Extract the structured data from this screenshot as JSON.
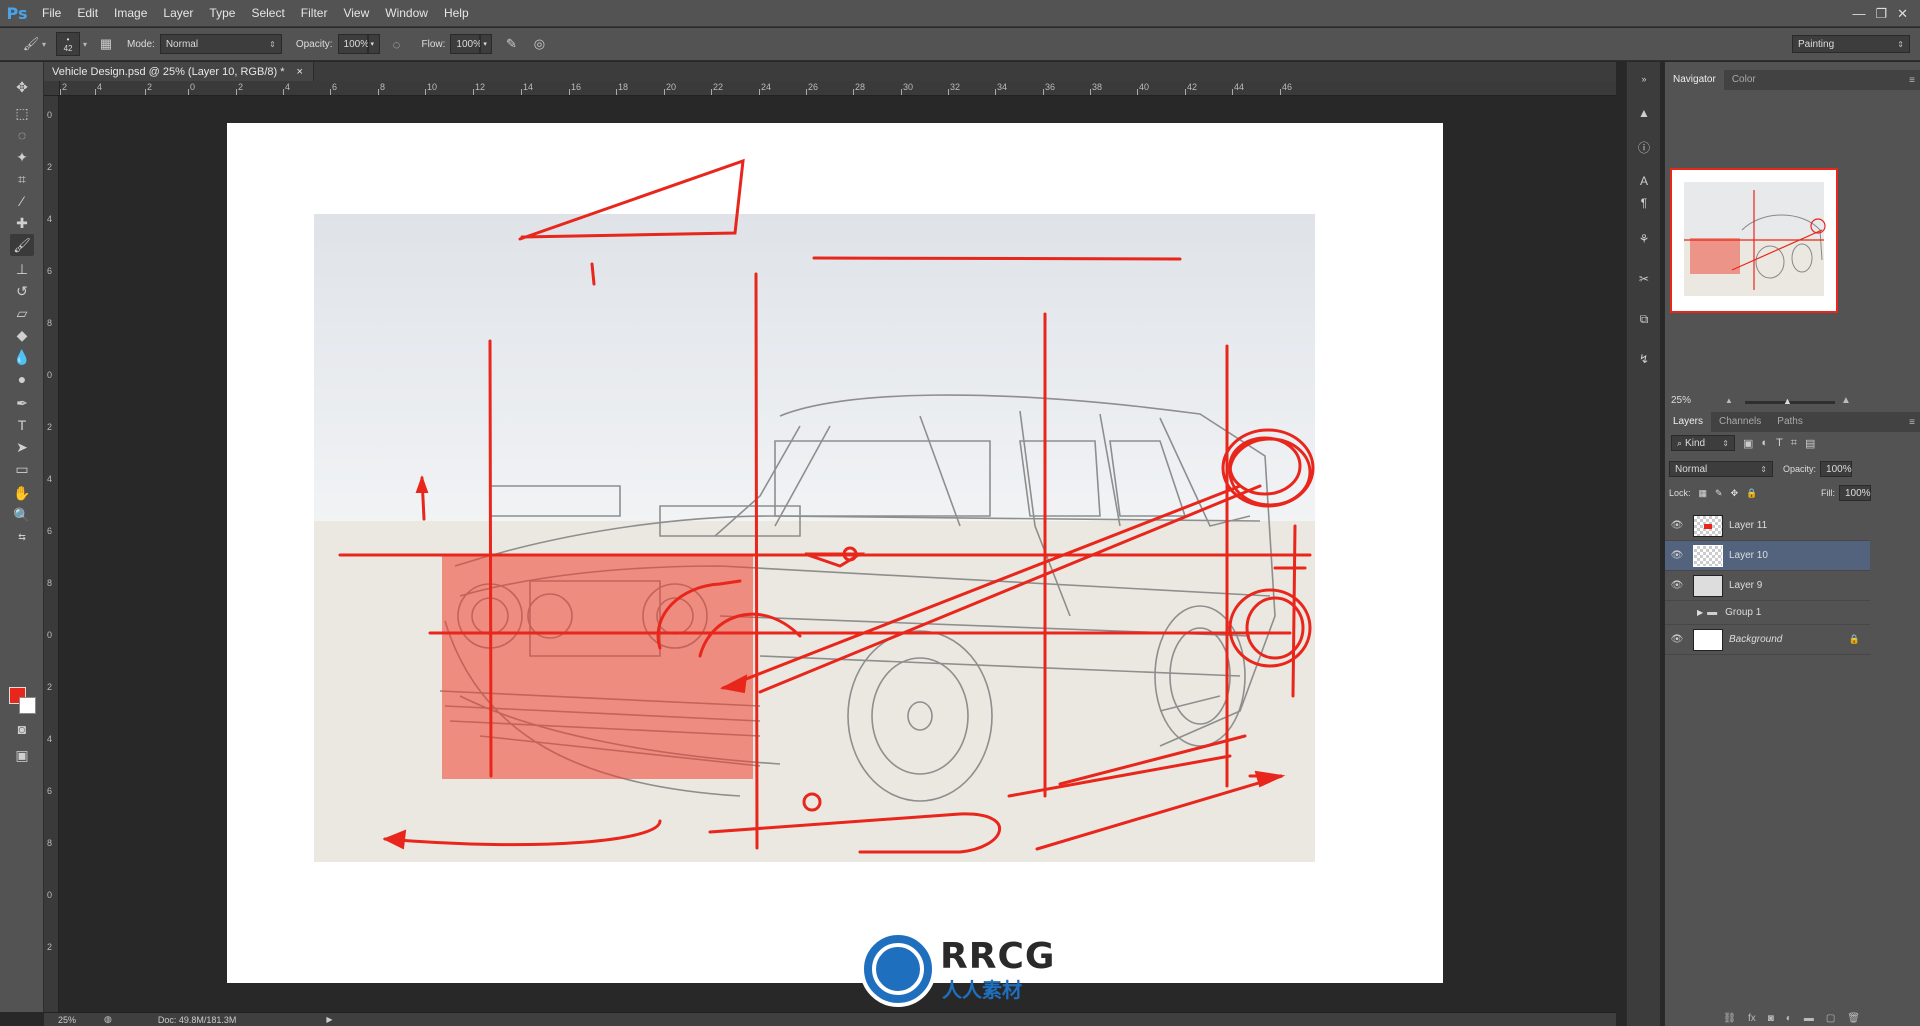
{
  "app": {
    "logo": "Ps"
  },
  "menu": [
    "File",
    "Edit",
    "Image",
    "Layer",
    "Type",
    "Select",
    "Filter",
    "View",
    "Window",
    "Help"
  ],
  "window_controls": [
    "—",
    "❐",
    "✕"
  ],
  "options": {
    "brush_size": "42",
    "mode_label": "Mode:",
    "mode_value": "Normal",
    "opacity_label": "Opacity:",
    "opacity_value": "100%",
    "flow_label": "Flow:",
    "flow_value": "100%",
    "workspace": "Painting"
  },
  "document_tab": {
    "title": "Vehicle Design.psd @ 25% (Layer 10, RGB/8) *",
    "close": "×"
  },
  "ruler_top_labels": [
    "2",
    "4",
    "2",
    "0",
    "2",
    "4",
    "6",
    "8",
    "10",
    "12",
    "14",
    "16",
    "18",
    "20",
    "22",
    "24",
    "26",
    "28",
    "30",
    "32",
    "34",
    "36",
    "38",
    "40",
    "42",
    "44",
    "46"
  ],
  "ruler_left_labels": [
    "0",
    "2",
    "4",
    "6",
    "8",
    "0",
    "2",
    "4",
    "6",
    "8",
    "0",
    "2",
    "4",
    "6",
    "8",
    "0",
    "2"
  ],
  "status": {
    "zoom": "25%",
    "doc": "Doc: 49.8M/181.3M"
  },
  "navigator": {
    "tabs": [
      "Navigator",
      "Color"
    ],
    "zoom": "25%"
  },
  "layers_panel": {
    "tabs": [
      "Layers",
      "Channels",
      "Paths"
    ],
    "filter": "Kind",
    "blend_mode": "Normal",
    "opacity_label": "Opacity:",
    "opacity_value": "100%",
    "lock_label": "Lock:",
    "fill_label": "Fill:",
    "fill_value": "100%",
    "layers": [
      {
        "name": "Layer 11",
        "visible": true,
        "selected": false
      },
      {
        "name": "Layer 10",
        "visible": true,
        "selected": true
      },
      {
        "name": "Layer 9",
        "visible": true,
        "selected": false
      },
      {
        "name": "Group 1",
        "visible": false,
        "selected": false
      },
      {
        "name": "Background",
        "visible": true,
        "selected": false
      }
    ]
  },
  "watermark": {
    "title": "RRCG",
    "subtitle": "人人素材"
  },
  "colors": {
    "foreground": "#e8261c",
    "background": "#ffffff",
    "sketch_red": "#e8261c"
  }
}
